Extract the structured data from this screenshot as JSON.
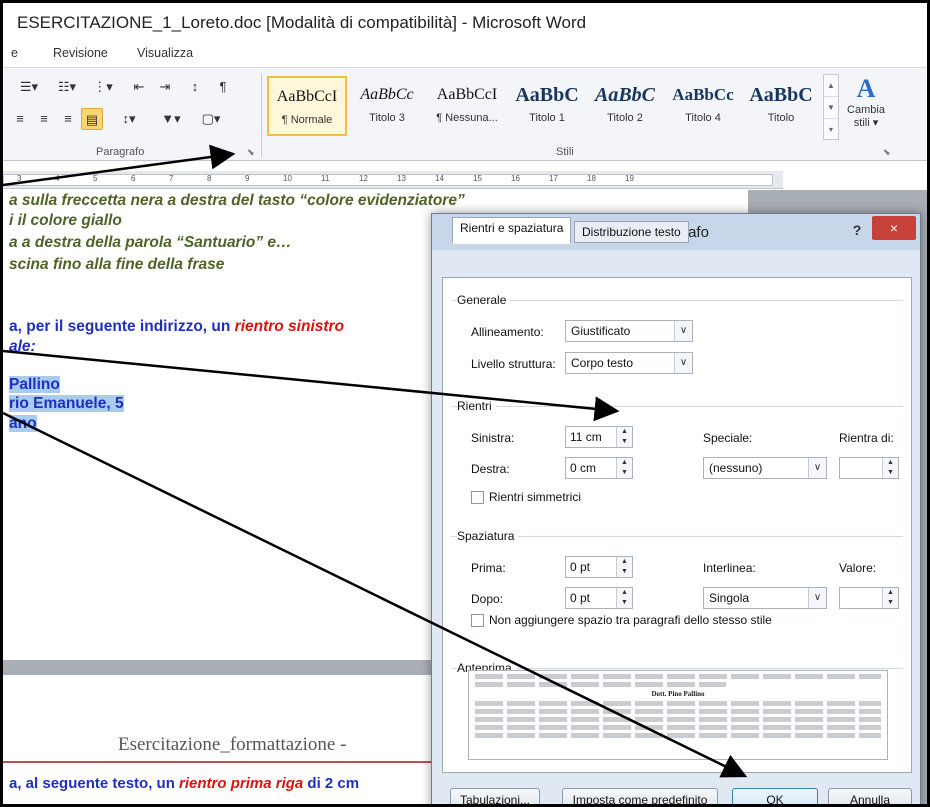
{
  "window": {
    "title": "ESERCITAZIONE_1_Loreto.doc [Modalità di compatibilità]  -  Microsoft Word"
  },
  "menu": {
    "items": [
      "e",
      "Revisione",
      "Visualizza"
    ]
  },
  "ribbon": {
    "paragraph_group_label": "Paragrafo",
    "styles_group_label": "Stili",
    "styles": [
      {
        "preview": "AaBbCcI",
        "name": "¶ Normale"
      },
      {
        "preview": "AaBbCc",
        "name": "Titolo 3"
      },
      {
        "preview": "AaBbCcI",
        "name": "¶ Nessuna..."
      },
      {
        "preview": "AaBbC",
        "name": "Titolo 1"
      },
      {
        "preview": "AaBbC",
        "name": "Titolo 2"
      },
      {
        "preview": "AaBbCc",
        "name": "Titolo 4"
      },
      {
        "preview": "AaBbC",
        "name": "Titolo"
      }
    ],
    "change_styles": {
      "line1": "Cambia",
      "line2": "stili ▾"
    }
  },
  "ruler": {
    "ticks": [
      "3",
      "4",
      "5",
      "6",
      "7",
      "8",
      "9",
      "10",
      "11",
      "12",
      "13",
      "14",
      "15",
      "16",
      "17",
      "18",
      "19"
    ]
  },
  "document": {
    "line1": "a sulla freccetta nera a destra del tasto “colore evidenziatore”",
    "line2": "i il colore giallo",
    "line3": "a a destra della parola “Santuario” e…",
    "line4": "scina fino alla fine della frase",
    "line5a": "a, per il seguente indirizzo, un ",
    "line5b": "rientro sinistro",
    "line6": "ale:",
    "addr1": "Pallino",
    "addr2": "rio Emanuele, 5",
    "addr3": "ano",
    "footer": "Esercitazione_formattazione  -",
    "bottom_a": "a, al seguente testo, un ",
    "bottom_b": "rientro prima riga",
    "bottom_c": " di 2 cm"
  },
  "dialog": {
    "title": "Paragrafo",
    "help": "?",
    "close": "×",
    "tabs": [
      "Rientri e spaziatura",
      "Distribuzione testo"
    ],
    "generale": {
      "section": "Generale",
      "align_label": "Allineamento:",
      "align_value": "Giustificato",
      "level_label": "Livello struttura:",
      "level_value": "Corpo testo"
    },
    "rientri": {
      "section": "Rientri",
      "left_label": "Sinistra:",
      "left_value": "11 cm",
      "right_label": "Destra:",
      "right_value": "0 cm",
      "special_label": "Speciale:",
      "special_value": "(nessuno)",
      "indent_by_label": "Rientra di:",
      "indent_by_value": "",
      "mirror_label": "Rientri simmetrici"
    },
    "spaziatura": {
      "section": "Spaziatura",
      "before_label": "Prima:",
      "before_value": "0 pt",
      "after_label": "Dopo:",
      "after_value": "0 pt",
      "line_label": "Interlinea:",
      "line_value": "Singola",
      "value_label": "Valore:",
      "value_value": "",
      "no_space_label": "Non aggiungere spazio tra paragrafi dello stesso stile"
    },
    "preview": {
      "section": "Anteprima",
      "sample": "Dott. Pino Pallino"
    },
    "buttons": {
      "tabs": "Tabulazioni...",
      "default": "Imposta come predefinito",
      "ok": "OK",
      "cancel": "Annulla"
    }
  },
  "colors": {
    "accent_highlight": "#aacbf0",
    "instruction_green": "#4f6228",
    "instruction_blue": "#1f2fbf",
    "instruction_red": "#e01010",
    "close_red": "#c7403a"
  }
}
